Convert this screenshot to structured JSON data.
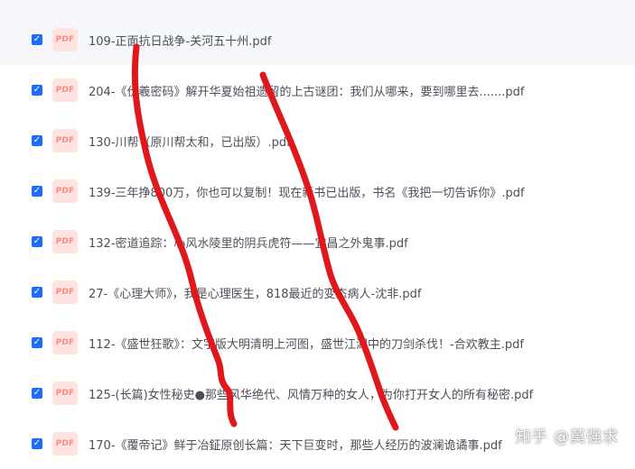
{
  "files": [
    {
      "name": "109-正面抗日战争-关河五十州.pdf",
      "checked": true
    },
    {
      "name": "204-《伏羲密码》解开华夏始祖遗留的上古谜团：我们从哪来，要到哪里去.......pdf",
      "checked": true
    },
    {
      "name": "130-川帮（原川帮太和，已出版）.pdf",
      "checked": true
    },
    {
      "name": "139-三年挣800万，你也可以复制！现在新书已出版，书名《我把一切告诉你》.pdf",
      "checked": true
    },
    {
      "name": "132-密道追踪：心风水陵里的阴兵虎符——宜昌之外鬼事.pdf",
      "checked": true
    },
    {
      "name": "27-《心理大师》，我是心理医生，818最近的变态病人-沈非.pdf",
      "checked": true
    },
    {
      "name": "112-《盛世狂歌》：文字版大明清明上河图，盛世江湖中的刀剑杀伐！-合欢教主.pdf",
      "checked": true
    },
    {
      "name": "125-(长篇)女性秘史●那些风华绝代、风情万种的女人，为你打开女人的所有秘密.pdf",
      "checked": true
    },
    {
      "name": "170-《覆帝记》鲜于冶鉦原创长篇：天下巨变时，那些人经历的波澜诡谲事.pdf",
      "checked": true
    }
  ],
  "icons": {
    "file_type": "PDF",
    "check": "✓"
  },
  "watermark": "知乎 @莫强求",
  "colors": {
    "checkbox": "#1a6ff5",
    "pdf_badge_bg": "#ffe3e1",
    "pdf_badge_text": "#ff8a80",
    "scribble": "#e0181c"
  }
}
